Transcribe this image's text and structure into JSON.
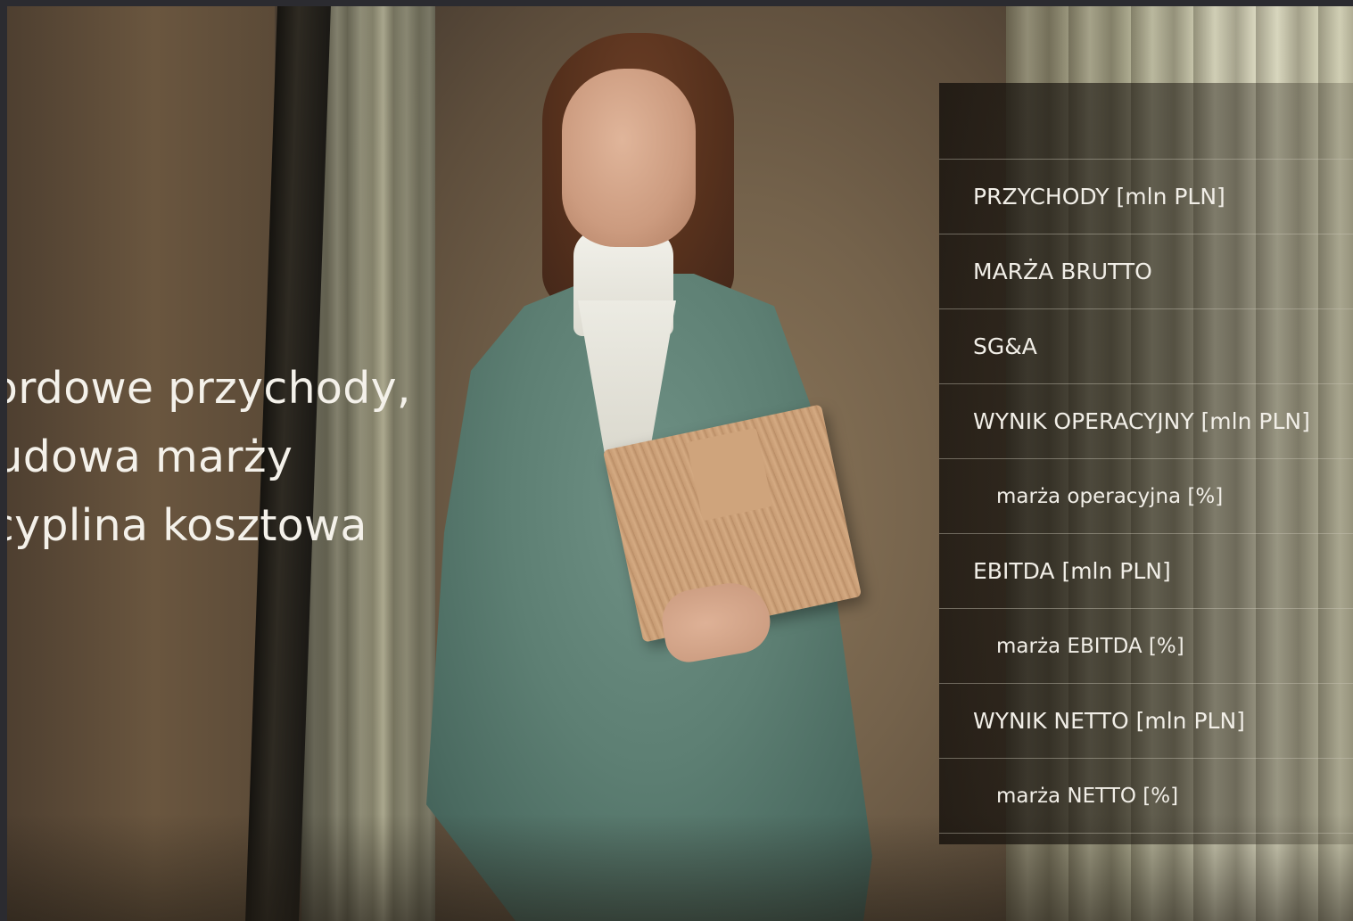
{
  "headline": {
    "lines": [
      "kordowe przychody,",
      "budowa marży",
      "scyplina kosztowa"
    ]
  },
  "metrics": {
    "rows": [
      {
        "label": "PRZYCHODY [mln PLN]",
        "level": "main"
      },
      {
        "label": "MARŻA BRUTTO",
        "level": "main"
      },
      {
        "label": "SG&A",
        "level": "main"
      },
      {
        "label": "WYNIK OPERACYJNY [mln PLN]",
        "level": "main"
      },
      {
        "label": "marża operacyjna [%]",
        "level": "sub"
      },
      {
        "label": "EBITDA [mln PLN]",
        "level": "main"
      },
      {
        "label": "marża EBITDA [%]",
        "level": "sub"
      },
      {
        "label": "WYNIK NETTO [mln PLN]",
        "level": "main"
      },
      {
        "label": "marża NETTO [%]",
        "level": "sub"
      }
    ]
  },
  "colors": {
    "text": "#f1eee7",
    "divider": "#c8c3b4",
    "page_border": "#2b2b30"
  }
}
